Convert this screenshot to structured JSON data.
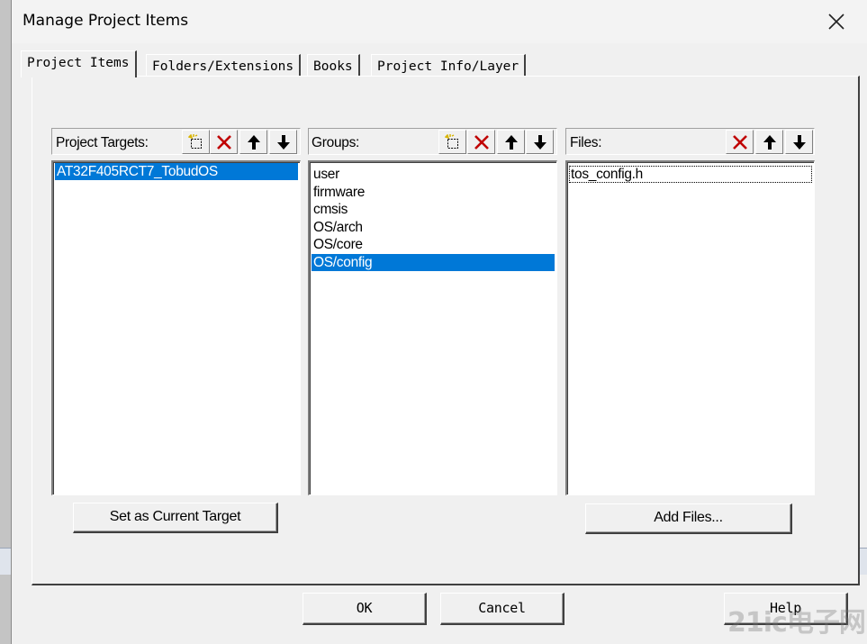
{
  "window": {
    "title": "Manage Project Items"
  },
  "tabs": [
    {
      "label": "Project Items",
      "active": true
    },
    {
      "label": "Folders/Extensions",
      "active": false
    },
    {
      "label": "Books",
      "active": false
    },
    {
      "label": "Project Info/Layer",
      "active": false
    }
  ],
  "targets": {
    "label": "Project Targets:",
    "items": [
      "AT32F405RCT7_TobudOS"
    ],
    "selected_index": 0,
    "set_current_label": "Set as Current Target"
  },
  "groups": {
    "label": "Groups:",
    "items": [
      "user",
      "firmware",
      "cmsis",
      "OS/arch",
      "OS/core",
      "OS/config"
    ],
    "selected_index": 5
  },
  "files": {
    "label": "Files:",
    "items": [
      "tos_config.h"
    ],
    "add_files_label": "Add Files..."
  },
  "footer": {
    "ok_label": "OK",
    "cancel_label": "Cancel",
    "help_label": "Help"
  },
  "watermark": "21ic电子网",
  "colors": {
    "selection": "#0078d7",
    "delete_icon": "#c00000"
  }
}
